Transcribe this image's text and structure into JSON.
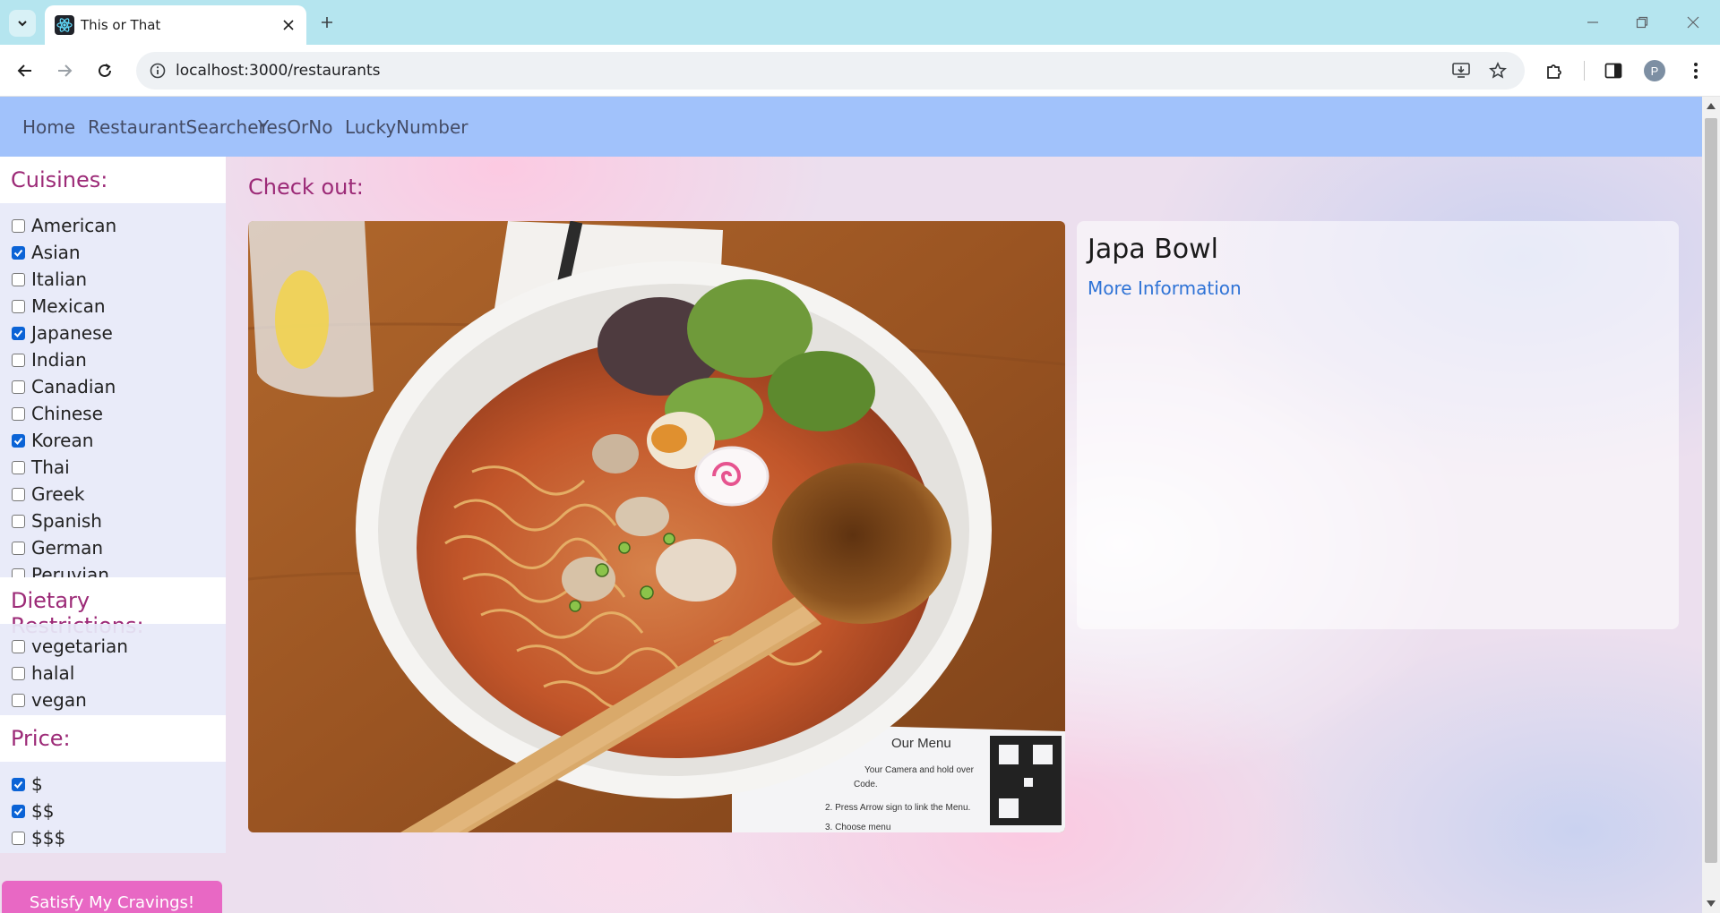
{
  "browser": {
    "tab_title": "This or That",
    "url": "localhost:3000/restaurants",
    "profile_initial": "P"
  },
  "nav": {
    "links": [
      "Home",
      "RestaurantSearcher",
      "YesOrNo",
      "LuckyNumber"
    ]
  },
  "filters": {
    "cuisines_title": "Cuisines:",
    "cuisines": [
      {
        "label": "American",
        "checked": false
      },
      {
        "label": "Asian",
        "checked": true
      },
      {
        "label": "Italian",
        "checked": false
      },
      {
        "label": "Mexican",
        "checked": false
      },
      {
        "label": "Japanese",
        "checked": true
      },
      {
        "label": "Indian",
        "checked": false
      },
      {
        "label": "Canadian",
        "checked": false
      },
      {
        "label": "Chinese",
        "checked": false
      },
      {
        "label": "Korean",
        "checked": true
      },
      {
        "label": "Thai",
        "checked": false
      },
      {
        "label": "Greek",
        "checked": false
      },
      {
        "label": "Spanish",
        "checked": false
      },
      {
        "label": "German",
        "checked": false
      },
      {
        "label": "Peruvian",
        "checked": false
      }
    ],
    "dietary_title": "Dietary Restrictions:",
    "dietary": [
      {
        "label": "vegetarian",
        "checked": false
      },
      {
        "label": "halal",
        "checked": false
      },
      {
        "label": "vegan",
        "checked": false
      }
    ],
    "price_title": "Price:",
    "price": [
      {
        "label": "$",
        "checked": true
      },
      {
        "label": "$$",
        "checked": true
      },
      {
        "label": "$$$",
        "checked": false
      }
    ],
    "submit_label": "Satisfy My Cravings!"
  },
  "main": {
    "heading": "Check out:",
    "photo_menu_heading": "Our Menu",
    "photo_menu_lines": [
      "Your Camera and hold over",
      "Code.",
      "2. Press Arrow sign to link the Menu.",
      "3. Choose menu"
    ],
    "restaurant_name": "Japa Bowl",
    "more_info_label": "More Information"
  },
  "colors": {
    "navbar_bg": "#a1c2fb",
    "heading": "#9c2a77",
    "link": "#2f73d6",
    "cta_bg": "#e868c4",
    "checkbox_on": "#0b63d6"
  }
}
